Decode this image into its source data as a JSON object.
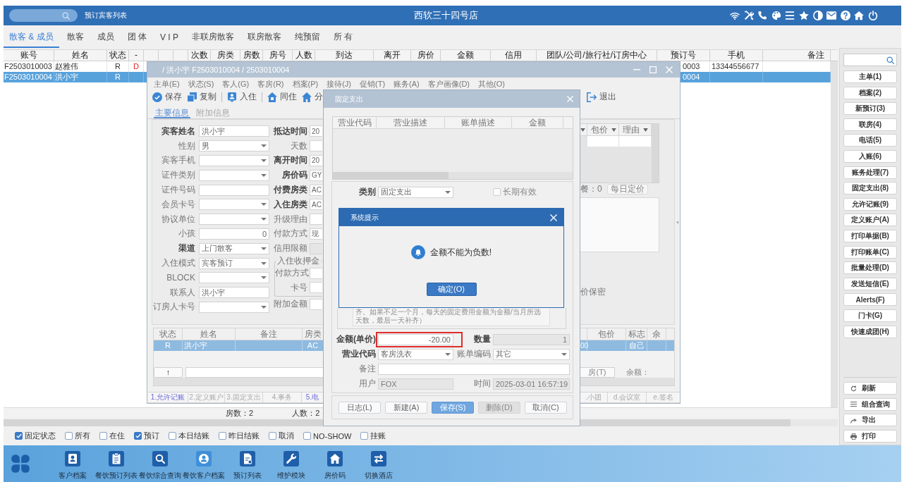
{
  "header": {
    "page_label": "预订宾客列表",
    "title": "西软三十四号店"
  },
  "tabs": [
    {
      "label": "散客 & 成员",
      "selected": true
    },
    {
      "label": "散客",
      "selected": false
    },
    {
      "label": "成员",
      "selected": false
    },
    {
      "label": "团 体",
      "selected": false
    },
    {
      "label": "V I P",
      "selected": false
    },
    {
      "label": "非联房散客",
      "selected": false
    },
    {
      "label": "联房散客",
      "selected": false
    },
    {
      "label": "纯预留",
      "selected": false
    },
    {
      "label": "所 有",
      "selected": false
    }
  ],
  "table": {
    "columns": [
      "账号",
      "姓名",
      "状态",
      "-",
      "次数",
      "房类",
      "房数",
      "房号",
      "人数",
      "到达",
      "离开",
      "房价",
      "金额",
      "信用",
      "团队/公司/旅行社/订房中心",
      "预订号",
      "手机",
      "备注"
    ],
    "rows": [
      {
        "selected": false,
        "account": "F2503010003",
        "name": "赵雅伟",
        "status": "R",
        "flag": "D",
        "reservation_no": "0003",
        "mobile": "13344556677"
      },
      {
        "selected": true,
        "account": "F2503010004",
        "name": "洪小宇",
        "status": "R",
        "reservation_no": "0004"
      }
    ]
  },
  "status_bar": {
    "room_count": "房数：2",
    "guest_count": "人数：2"
  },
  "sidebar": {
    "buttons": [
      "主单(1)",
      "档案(2)",
      "新预订(3)",
      "联房(4)",
      "电话(5)",
      "入账(6)",
      "账务处理(7)",
      "固定支出(8)",
      "允许记账(9)",
      "定义账户(A)",
      "打印单据(B)",
      "打印账单(C)",
      "批量处理(D)",
      "发送短信(E)",
      "Alerts(F)",
      "门卡(G)",
      "快速成团(H)"
    ],
    "tools": [
      {
        "kind": "refresh",
        "label": "刷新"
      },
      {
        "kind": "query",
        "label": "组合查询"
      },
      {
        "kind": "export",
        "label": "导出"
      },
      {
        "kind": "print",
        "label": "打印"
      }
    ]
  },
  "filters": [
    {
      "label": "固定状态",
      "checked": true
    },
    {
      "label": "所有",
      "checked": false
    },
    {
      "label": "在住",
      "checked": false
    },
    {
      "label": "预订",
      "checked": true
    },
    {
      "label": "本日结账",
      "checked": false
    },
    {
      "label": "昨日结账",
      "checked": false
    },
    {
      "label": "取消",
      "checked": false
    },
    {
      "label": "NO-SHOW",
      "checked": false
    },
    {
      "label": "挂账",
      "checked": false
    }
  ],
  "taskbar": [
    {
      "kind": "profile",
      "label": "客户档案"
    },
    {
      "kind": "clipboard",
      "label": "餐饮预订列表"
    },
    {
      "kind": "search",
      "label": "餐饮综合查询"
    },
    {
      "kind": "user",
      "label": "餐饮客户档案"
    },
    {
      "kind": "document",
      "label": "预订列表"
    },
    {
      "kind": "wrench",
      "label": "维护模块"
    },
    {
      "kind": "home",
      "label": "房价码"
    },
    {
      "kind": "swap",
      "label": "切换酒店"
    }
  ],
  "guest_window": {
    "title": "/ 洪小宇 F2503010004 / 2503010004",
    "menu": [
      "主单(E)",
      "状态(S)",
      "客人(G)",
      "客房(R)",
      "档案(P)",
      "接待(J)",
      "促销(T)",
      "账务(A)",
      "客户画像(D)",
      "其他(O)"
    ],
    "toolbar": [
      {
        "kind": "save",
        "label": "保存"
      },
      {
        "kind": "copy",
        "label": "复制"
      },
      {
        "kind": "separator"
      },
      {
        "kind": "checkin",
        "label": "入住"
      },
      {
        "kind": "separator"
      },
      {
        "kind": "share",
        "label": "同住"
      },
      {
        "kind": "assign",
        "label": "分"
      }
    ],
    "toolbar_right": [
      {
        "kind": "exit",
        "label": "退出"
      }
    ],
    "form_tabs": [
      {
        "label": "主要信息",
        "selected": true
      },
      {
        "label": "附加信息",
        "selected": false
      }
    ],
    "fields": [
      {
        "label": "宾客姓名",
        "required": true,
        "kind": "text",
        "value": "洪小宇"
      },
      {
        "label": "性别",
        "required": false,
        "kind": "select",
        "value": "男"
      },
      {
        "label": "宾客手机",
        "required": false,
        "kind": "select"
      },
      {
        "label": "证件类别",
        "required": false,
        "kind": "select"
      },
      {
        "label": "证件号码",
        "required": false,
        "kind": "text"
      },
      {
        "label": "会员卡号",
        "required": false,
        "kind": "select"
      },
      {
        "label": "协议单位",
        "required": false,
        "kind": "select"
      },
      {
        "label": "小孩",
        "required": false,
        "kind": "number",
        "value": "0"
      },
      {
        "label": "渠道",
        "required": true,
        "kind": "select",
        "value": "上门散客"
      },
      {
        "label": "入住模式",
        "required": false,
        "kind": "select",
        "value": "宾客预订"
      },
      {
        "label": "BLOCK",
        "required": false,
        "kind": "select"
      },
      {
        "label": "联系人",
        "required": false,
        "kind": "text",
        "value": "洪小宇"
      },
      {
        "label": "订房人卡号",
        "required": false,
        "kind": "select"
      }
    ],
    "stay_fields": [
      {
        "label": "抵达时间",
        "required": true,
        "disabled": false,
        "value": "20"
      },
      {
        "label": "天数",
        "required": false,
        "disabled": false
      },
      {
        "label": "离开时间",
        "required": true,
        "disabled": false,
        "value": "20"
      },
      {
        "label": "房价码",
        "required": true,
        "disabled": false,
        "value": "GY"
      },
      {
        "label": "付费房类",
        "required": true,
        "disabled": false,
        "value": "AC"
      },
      {
        "label": "入住房类",
        "required": true,
        "disabled": false,
        "value": "AC"
      },
      {
        "label": "升级理由",
        "required": false,
        "disabled": false
      },
      {
        "label": "付款方式",
        "required": false,
        "disabled": false,
        "value": "现"
      },
      {
        "label": "信用限额",
        "required": false,
        "disabled": true
      }
    ],
    "deposit_group": {
      "title": "入住收押金",
      "fields": [
        {
          "label": "付款方式"
        },
        {
          "label": "卡号"
        }
      ]
    },
    "extra_field": {
      "label": "附加金额"
    },
    "rate_grid": {
      "columns": [
        "包价",
        "理由"
      ]
    },
    "breakfast": "餐：0",
    "daily_rate_button": "每日定价",
    "rate_secret": "价保密",
    "guest_list": {
      "columns": [
        "状态",
        "姓名",
        "备注",
        "房类"
      ],
      "columns_right": [
        "包价",
        "标志",
        "余"
      ],
      "rows": [
        {
          "selected": true,
          "status": "R",
          "name": "洪小宇",
          "room_type": "AC",
          "column_cut": "00",
          "flag": "自己"
        }
      ]
    },
    "up_button": "↑",
    "room_button": "房(T)",
    "balance_label": "余额：",
    "bottom_tabs": [
      {
        "label": "1.允许记账",
        "has_data": true
      },
      {
        "label": "2.定义账户",
        "has_data": false
      },
      {
        "label": "3.固定支出",
        "has_data": false
      },
      {
        "label": "4.事务",
        "has_data": false
      },
      {
        "label": "5.电",
        "has_data": true
      }
    ],
    "bottom_tabs_right": [
      {
        "label": ".小团",
        "has_data": false
      },
      {
        "label": "d.会议室",
        "has_data": false
      },
      {
        "label": "e.签名",
        "has_data": false
      }
    ]
  },
  "expense_dialog": {
    "title": "固定支出",
    "columns": [
      "营业代码",
      "营业描述",
      "账单描述",
      "金额"
    ],
    "category": {
      "label": "类别",
      "value": "固定支出"
    },
    "long_term": {
      "label": "长期有效",
      "checked": false
    },
    "note": "齐。如果不足一个月，每天的固定费用金额为金额/当月所选天数，最后一天补齐）",
    "fields": [
      {
        "label": "金额(单价)",
        "required": true,
        "kind": "number",
        "value": "-20.00",
        "highlighted": true,
        "disabled": false
      },
      {
        "label": "数量",
        "required": true,
        "kind": "number",
        "value": "1",
        "highlighted": false,
        "disabled": true
      },
      {
        "label": "营业代码",
        "required": true,
        "kind": "select",
        "value": "客房洗衣",
        "highlighted": false,
        "disabled": false
      },
      {
        "label": "账单编码",
        "required": false,
        "kind": "select",
        "value": "其它",
        "highlighted": false,
        "disabled": false
      },
      {
        "label": "备注",
        "required": false,
        "kind": "memo",
        "highlighted": false,
        "disabled": false
      },
      {
        "label": "用户",
        "required": false,
        "kind": "text",
        "value": "FOX",
        "highlighted": false,
        "disabled": true
      },
      {
        "label": "时间",
        "required": false,
        "kind": "text",
        "value": "2025-03-01 16:57:19",
        "highlighted": false,
        "disabled": true
      }
    ],
    "buttons": [
      {
        "label": "日志(L)",
        "primary": false,
        "disabled": false
      },
      {
        "label": "新建(A)",
        "primary": false,
        "disabled": false
      },
      {
        "label": "保存(S)",
        "primary": true,
        "disabled": false
      },
      {
        "label": "删除(D)",
        "primary": false,
        "disabled": true
      },
      {
        "label": "取消(C)",
        "primary": false,
        "disabled": false
      }
    ]
  },
  "alert": {
    "title": "系统提示",
    "message": "金额不能为负数!",
    "button": "确定(O)"
  }
}
